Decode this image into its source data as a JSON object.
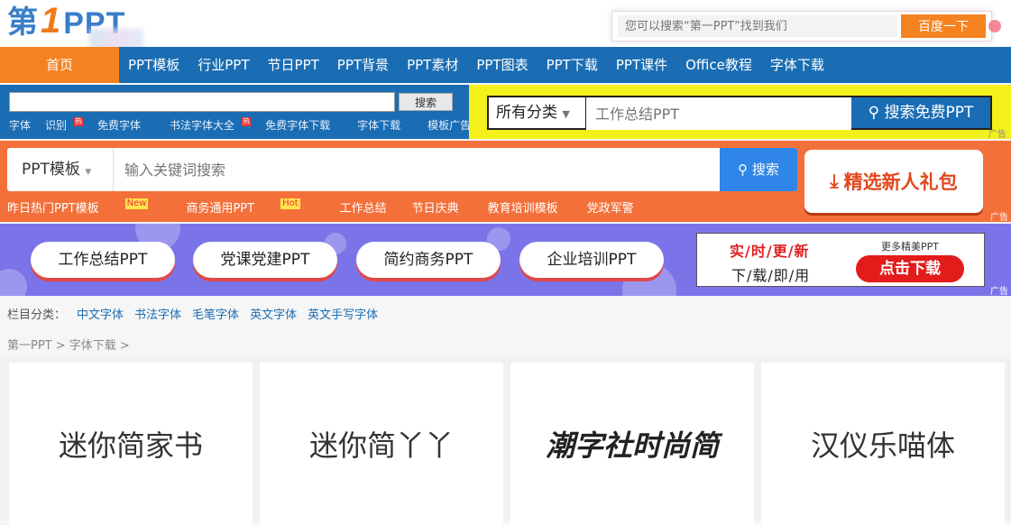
{
  "header": {
    "logo_prefix": "第",
    "logo_one": "1",
    "logo_suffix": "PPT",
    "search_placeholder": "您可以搜索“第一PPT”找到我们",
    "search_button": "百度一下"
  },
  "nav": {
    "items": [
      "首页",
      "PPT模板",
      "行业PPT",
      "节日PPT",
      "PPT背景",
      "PPT素材",
      "PPT图表",
      "PPT下载",
      "PPT课件",
      "Office教程",
      "字体下载"
    ]
  },
  "ad1": {
    "search_button": "搜索",
    "links": [
      "字体",
      "识别",
      "免费字体",
      "书法字体大全",
      "免费字体下载",
      "字体下载",
      "模板广告"
    ],
    "category_select": "所有分类",
    "category_placeholder": "工作总结PPT",
    "category_button": "搜索免费PPT",
    "ad_label": "广告"
  },
  "ad2": {
    "select": "PPT模板",
    "placeholder": "输入关键词搜索",
    "search_button": "搜索",
    "gift_button": "精选新人礼包",
    "hot_links": [
      {
        "label": "昨日热门PPT模板",
        "badge": "New"
      },
      {
        "label": "商务通用PPT",
        "badge": "Hot"
      },
      {
        "label": "工作总结",
        "badge": ""
      },
      {
        "label": "节日庆典",
        "badge": ""
      },
      {
        "label": "教育培训模板",
        "badge": ""
      },
      {
        "label": "党政军警",
        "badge": ""
      }
    ],
    "ad_label": "广告"
  },
  "ad3": {
    "pills": [
      "工作总结PPT",
      "党课党建PPT",
      "简约商务PPT",
      "企业培训PPT"
    ],
    "promo_red": "实/时/更/新",
    "promo_black": "下/载/即/用",
    "promo_more": "更多精美PPT",
    "promo_button": "点击下载",
    "ad_label": "广告"
  },
  "category": {
    "label": "栏目分类：",
    "links": [
      "中文字体",
      "书法字体",
      "毛笔字体",
      "英文字体",
      "英文手写字体"
    ]
  },
  "breadcrumb": "第一PPT > 字体下载 >",
  "cards": [
    "迷你简家书",
    "迷你简丫丫",
    "潮字社时尚简",
    "汉仪乐喵体"
  ],
  "colors": {
    "brand_blue": "#1a6db3",
    "brand_orange": "#f58220",
    "ad_yellow": "#f4f01c",
    "ad_orange": "#f4703a",
    "ad_purple": "#7b74e8"
  }
}
